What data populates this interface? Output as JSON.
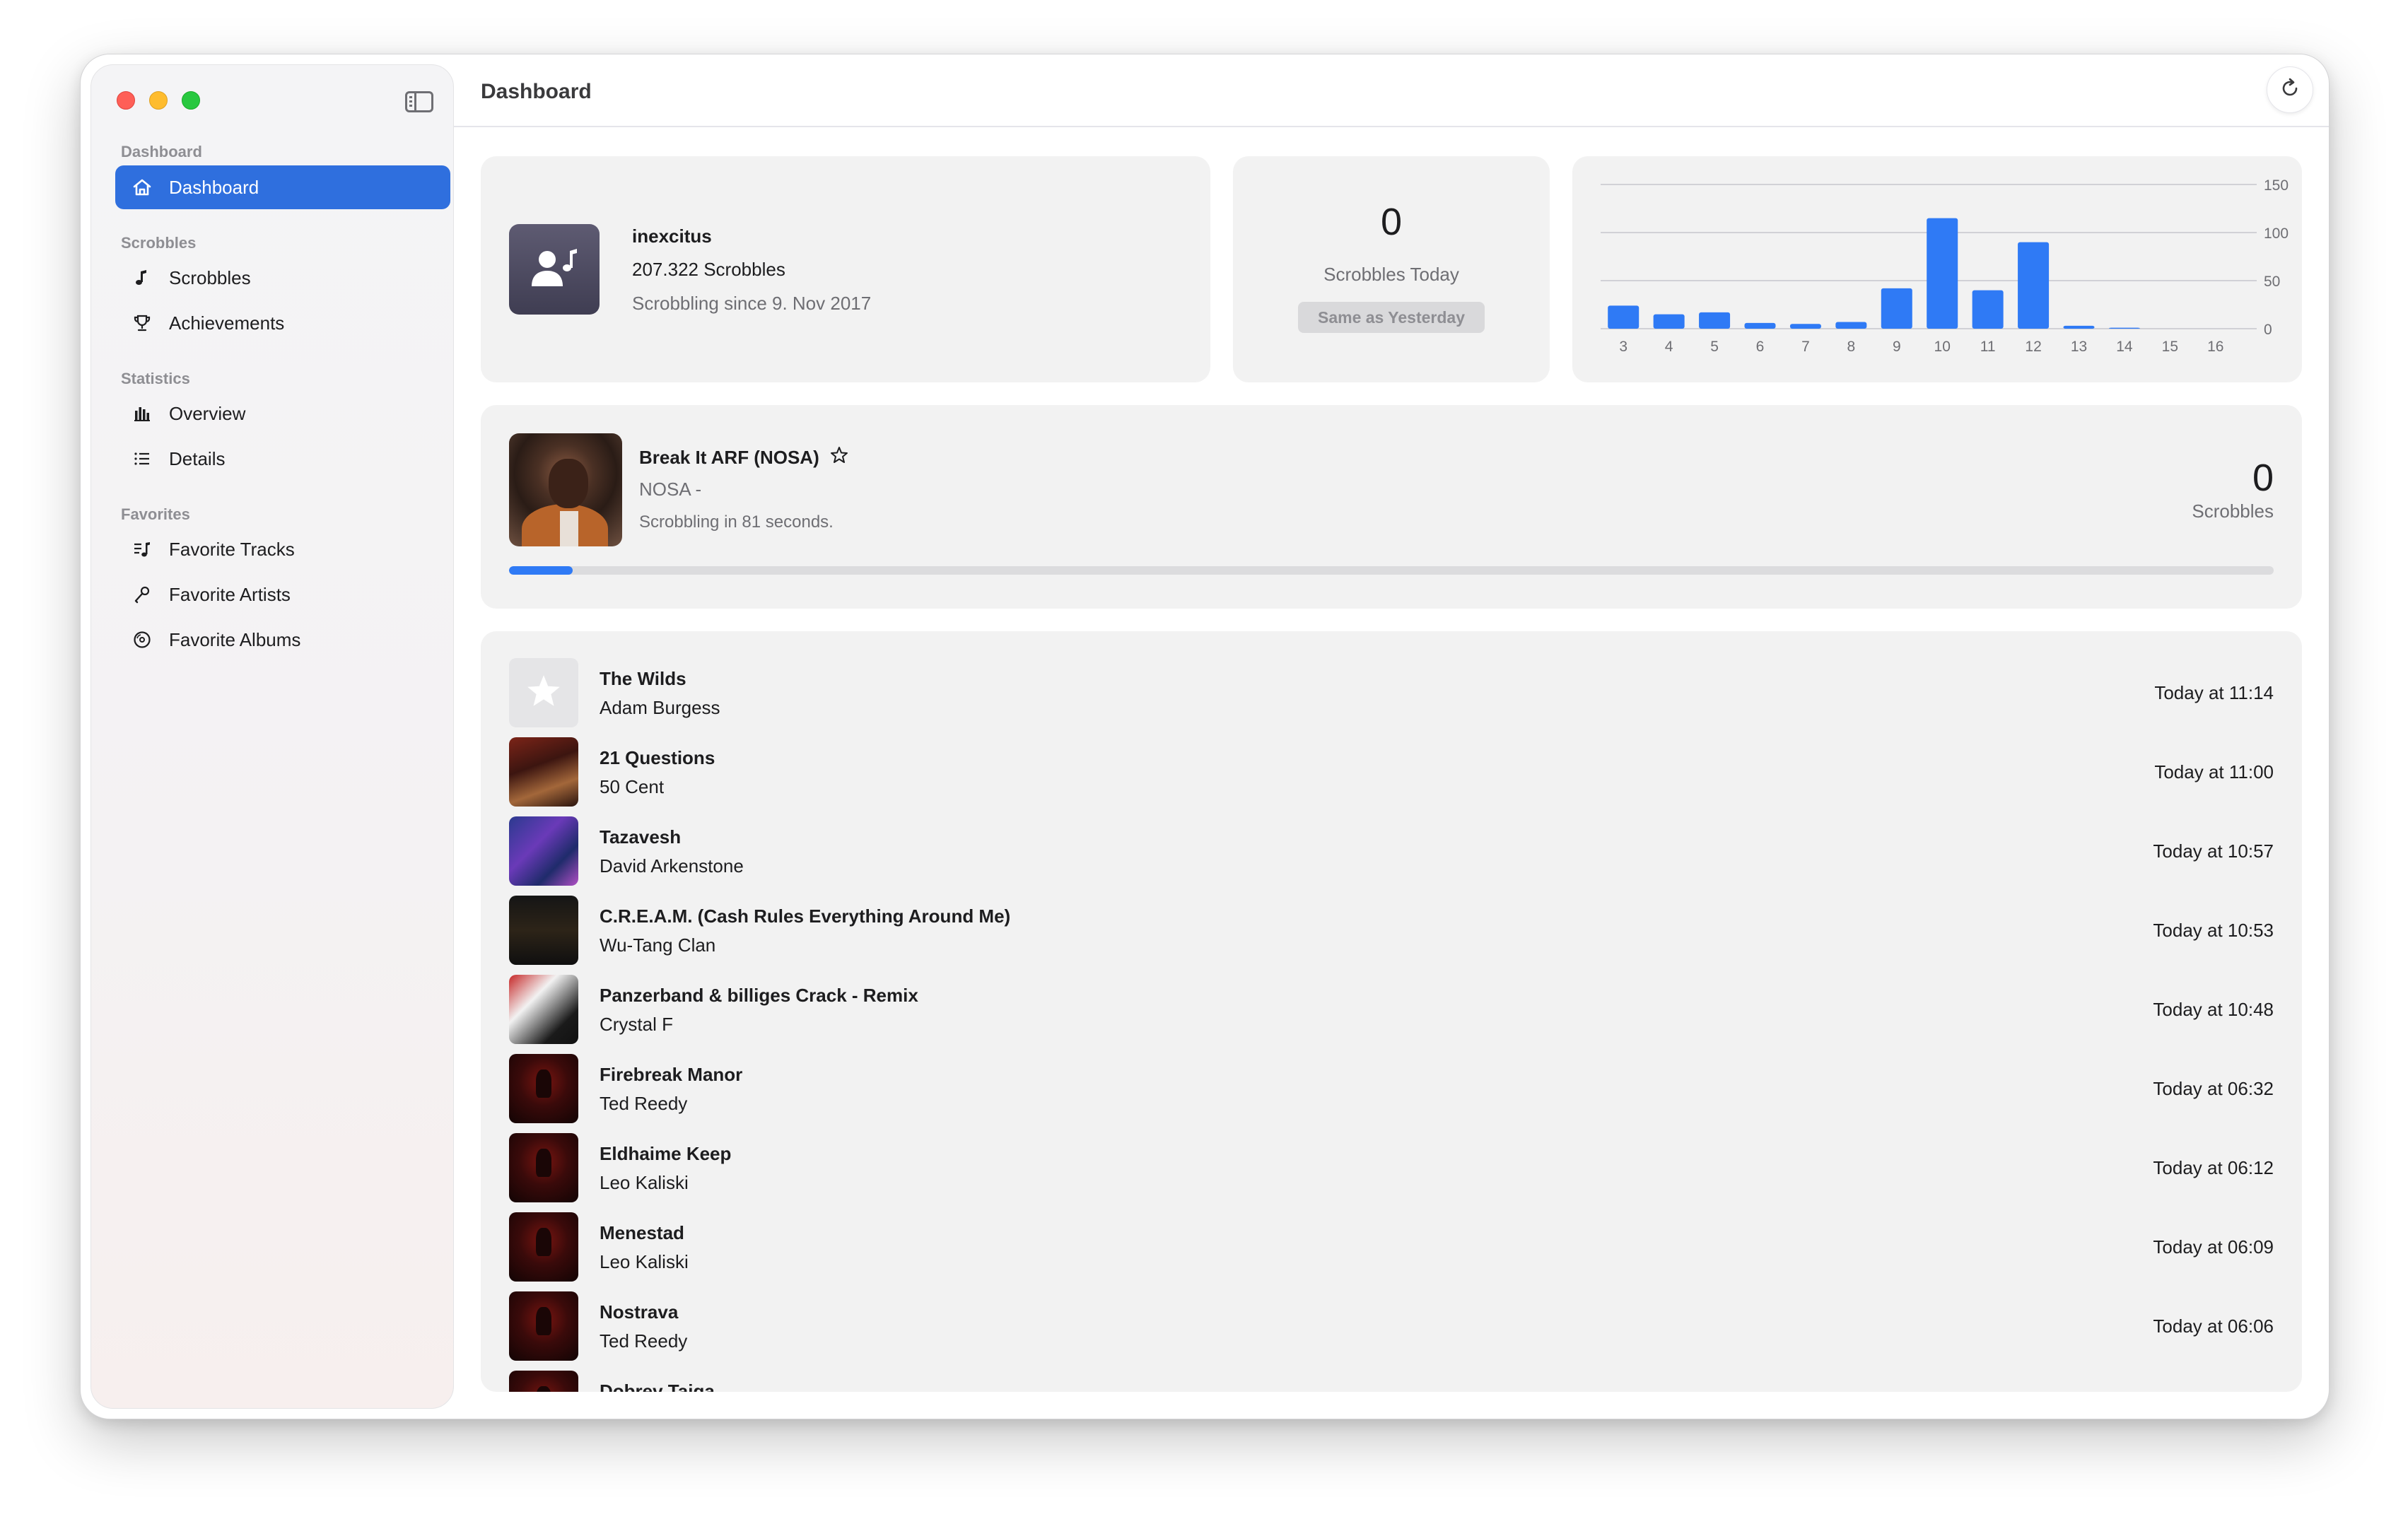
{
  "window": {
    "title": "Dashboard"
  },
  "sidebar": {
    "sections": [
      {
        "label": "Dashboard",
        "items": [
          {
            "label": "Dashboard",
            "icon": "house-icon",
            "active": true
          }
        ]
      },
      {
        "label": "Scrobbles",
        "items": [
          {
            "label": "Scrobbles",
            "icon": "music-note-icon"
          },
          {
            "label": "Achievements",
            "icon": "trophy-icon"
          }
        ]
      },
      {
        "label": "Statistics",
        "items": [
          {
            "label": "Overview",
            "icon": "chart-bars-icon"
          },
          {
            "label": "Details",
            "icon": "list-icon"
          }
        ]
      },
      {
        "label": "Favorites",
        "items": [
          {
            "label": "Favorite Tracks",
            "icon": "music-list-icon"
          },
          {
            "label": "Favorite Artists",
            "icon": "microphone-icon"
          },
          {
            "label": "Favorite Albums",
            "icon": "record-icon"
          }
        ]
      }
    ]
  },
  "profile": {
    "username": "inexcitus",
    "scrobbles": "207.322 Scrobbles",
    "since": "Scrobbling since 9. Nov 2017"
  },
  "today": {
    "count": "0",
    "label": "Scrobbles Today",
    "badge": "Same as Yesterday"
  },
  "chart_data": {
    "type": "bar",
    "categories": [
      "3",
      "4",
      "5",
      "6",
      "7",
      "8",
      "9",
      "10",
      "11",
      "12",
      "13",
      "14",
      "15",
      "16"
    ],
    "values": [
      24,
      15,
      17,
      6,
      5,
      7,
      42,
      115,
      40,
      90,
      3,
      1,
      0,
      0
    ],
    "ylim": [
      0,
      150
    ],
    "yticks": [
      "0",
      "50",
      "100",
      "150"
    ],
    "grid": true,
    "bar_color": "#2f7af5"
  },
  "now_playing": {
    "title": "Break It ARF (NOSA)",
    "artist": "NOSA -",
    "status": "Scrobbling in 81 seconds.",
    "count": "0",
    "count_label": "Scrobbles",
    "progress": 0.036
  },
  "recent": [
    {
      "title": "The Wilds",
      "artist": "Adam Burgess",
      "time": "Today at 11:14",
      "art": "placeholder"
    },
    {
      "title": "21 Questions",
      "artist": "50 Cent",
      "time": "Today at 11:00",
      "art": "50"
    },
    {
      "title": "Tazavesh",
      "artist": "David Arkenstone",
      "time": "Today at 10:57",
      "art": "taz"
    },
    {
      "title": "C.R.E.A.M. (Cash Rules Everything Around Me)",
      "artist": "Wu-Tang Clan",
      "time": "Today at 10:53",
      "art": "cream"
    },
    {
      "title": "Panzerband & billiges Crack - Remix",
      "artist": "Crystal F",
      "time": "Today at 10:48",
      "art": "panzer"
    },
    {
      "title": "Firebreak Manor",
      "artist": "Ted Reedy",
      "time": "Today at 06:32",
      "art": "diablo"
    },
    {
      "title": "Eldhaime Keep",
      "artist": "Leo Kaliski",
      "time": "Today at 06:12",
      "art": "diablo"
    },
    {
      "title": "Menestad",
      "artist": "Leo Kaliski",
      "time": "Today at 06:09",
      "art": "diablo"
    },
    {
      "title": "Nostrava",
      "artist": "Ted Reedy",
      "time": "Today at 06:06",
      "art": "diablo"
    },
    {
      "title": "Dobrev Taiga",
      "artist": "",
      "time": "",
      "art": "diablo"
    }
  ]
}
